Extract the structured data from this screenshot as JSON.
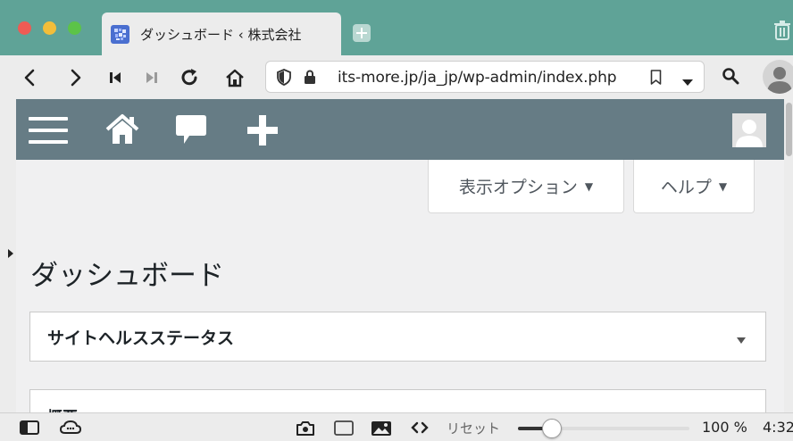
{
  "browser": {
    "tab": {
      "title": "ダッシュボード ‹ 株式会社"
    },
    "url": "its-more.jp/ja_jp/wp-admin/index.php",
    "colors": {
      "tabbar": "#5fa397",
      "chrome": "#ececec"
    }
  },
  "admin_bar": {
    "icons": [
      "menu-icon",
      "home-icon",
      "comment-icon",
      "plus-icon",
      "avatar-icon"
    ],
    "color": "#667c85"
  },
  "screen_meta": {
    "screen_options_label": "表示オプション",
    "help_label": "ヘルプ",
    "arrow": "▼"
  },
  "page": {
    "title": "ダッシュボード",
    "panels": [
      {
        "title": "サイトヘルスステータス"
      },
      {
        "title": "概要"
      }
    ]
  },
  "statusbar": {
    "reset_label": "リセット",
    "zoom_percent": 100,
    "zoom_label": "100 %",
    "zoom_level_fraction": 0.2,
    "clock": "4:32"
  }
}
